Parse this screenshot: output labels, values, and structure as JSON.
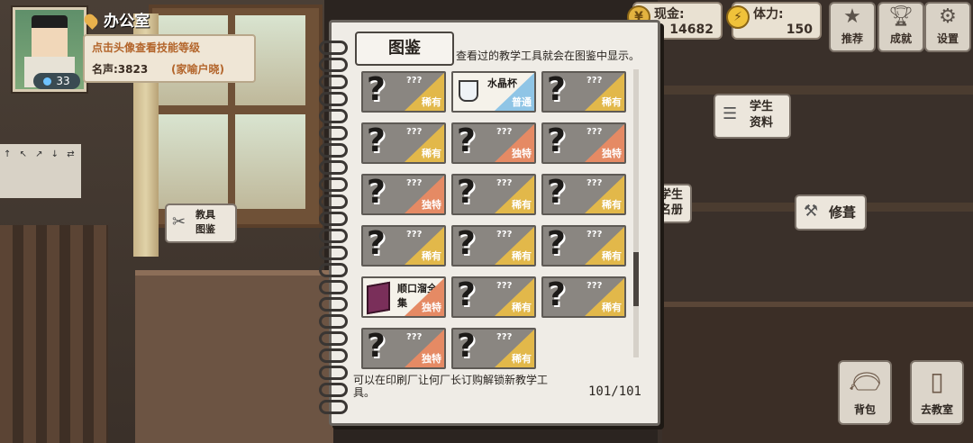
{
  "header": {
    "location": "办公室",
    "profile_hint": "点击头像查看技能等级",
    "fame": "名声:3823",
    "title": "(家喻户晓)",
    "level": "33"
  },
  "stats": {
    "cash_label": "现金:",
    "cash_value": "14682",
    "stamina_label": "体力:",
    "stamina_value": "150"
  },
  "top_buttons": [
    {
      "label": "推荐",
      "icon": "star-icon"
    },
    {
      "label": "成就",
      "icon": "trophy-icon"
    },
    {
      "label": "设置",
      "icon": "gear-icon"
    }
  ],
  "bubbles": {
    "tool_catalog": "教具\n图鉴",
    "student_info": "学生\n资料",
    "student_roster": "学生\n名册",
    "repair": "修葺"
  },
  "poster_text": "↑ ↖ ↗ ↓ ⇄",
  "notebook": {
    "title": "图鉴",
    "subtitle": "查看过的教学工具就会在图鉴中显示。",
    "footer": "可以在印刷厂让何厂长订购解锁新教学工具。",
    "count": "101/101",
    "scroll_position": 0.78,
    "items": [
      {
        "name": "???",
        "rarity": "稀有",
        "color": "#e2b84a",
        "locked": true
      },
      {
        "name": "水晶杯",
        "rarity": "普通",
        "color": "#8fc5e6",
        "locked": false,
        "icon": "cup-icon"
      },
      {
        "name": "???",
        "rarity": "稀有",
        "color": "#e2b84a",
        "locked": true
      },
      {
        "name": "???",
        "rarity": "稀有",
        "color": "#e2b84a",
        "locked": true
      },
      {
        "name": "???",
        "rarity": "独特",
        "color": "#e58a64",
        "locked": true
      },
      {
        "name": "???",
        "rarity": "独特",
        "color": "#e58a64",
        "locked": true
      },
      {
        "name": "???",
        "rarity": "独特",
        "color": "#e58a64",
        "locked": true
      },
      {
        "name": "???",
        "rarity": "稀有",
        "color": "#e2b84a",
        "locked": true
      },
      {
        "name": "???",
        "rarity": "稀有",
        "color": "#e2b84a",
        "locked": true
      },
      {
        "name": "???",
        "rarity": "稀有",
        "color": "#e2b84a",
        "locked": true
      },
      {
        "name": "???",
        "rarity": "稀有",
        "color": "#e2b84a",
        "locked": true
      },
      {
        "name": "???",
        "rarity": "稀有",
        "color": "#e2b84a",
        "locked": true
      },
      {
        "name": "顺口溜全集",
        "rarity": "独特",
        "color": "#e58a64",
        "locked": false,
        "icon": "book-icon"
      },
      {
        "name": "???",
        "rarity": "稀有",
        "color": "#e2b84a",
        "locked": true
      },
      {
        "name": "???",
        "rarity": "稀有",
        "color": "#e2b84a",
        "locked": true
      },
      {
        "name": "???",
        "rarity": "独特",
        "color": "#e58a64",
        "locked": true
      },
      {
        "name": "???",
        "rarity": "稀有",
        "color": "#e2b84a",
        "locked": true
      }
    ]
  },
  "bottom_buttons": [
    {
      "label": "背包",
      "icon": "bag-icon"
    },
    {
      "label": "去教室",
      "icon": "door-icon"
    }
  ]
}
